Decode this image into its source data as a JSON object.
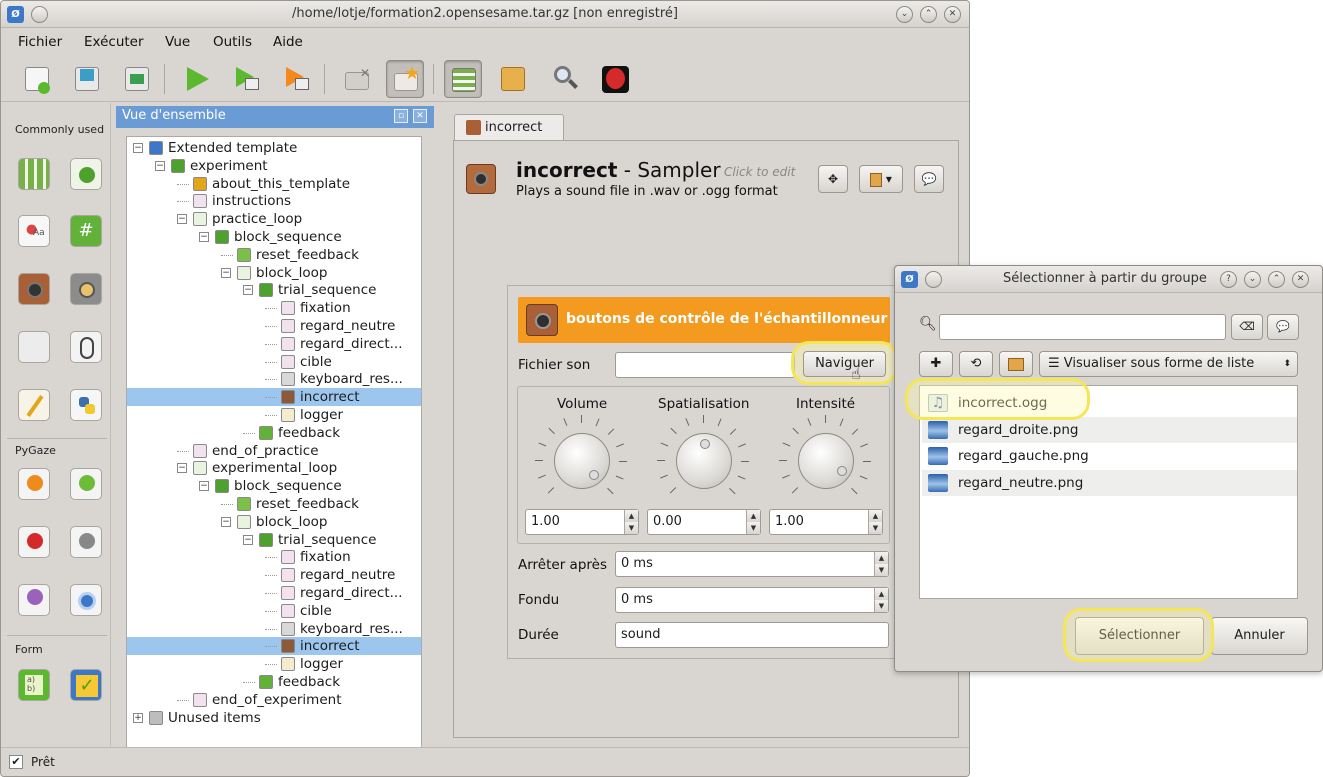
{
  "window": {
    "title": "/home/lotje/formation2.opensesame.tar.gz [non enregistré]",
    "app_icon": "opensesame-icon"
  },
  "menu": [
    "Fichier",
    "Exécuter",
    "Vue",
    "Outils",
    "Aide"
  ],
  "toolbar": {
    "icons": [
      "new-file-icon",
      "open-file-icon",
      "save-file-icon",
      "run-icon",
      "run-window-icon",
      "quick-run-icon",
      "close-tabs-icon",
      "close-other-tabs-icon",
      "overview-icon",
      "file-pool-icon",
      "debug-window-icon",
      "bug-icon"
    ]
  },
  "item_toolbar": {
    "categories": [
      "Commonly used",
      "PyGaze",
      "Form"
    ]
  },
  "overview": {
    "title": "Vue d'ensemble",
    "tree": [
      {
        "label": "Extended template",
        "depth": 0,
        "icon": "experiment-root-icon",
        "exp": "minus"
      },
      {
        "label": "experiment",
        "depth": 1,
        "icon": "sequence-icon",
        "exp": "minus"
      },
      {
        "label": "about_this_template",
        "depth": 2,
        "icon": "notepad-icon"
      },
      {
        "label": "instructions",
        "depth": 2,
        "icon": "sketchpad-icon"
      },
      {
        "label": "practice_loop",
        "depth": 2,
        "icon": "loop-icon",
        "exp": "minus"
      },
      {
        "label": "block_sequence",
        "depth": 3,
        "icon": "sequence-icon",
        "exp": "minus"
      },
      {
        "label": "reset_feedback",
        "depth": 4,
        "icon": "reset-feedback-icon"
      },
      {
        "label": "block_loop",
        "depth": 4,
        "icon": "loop-icon",
        "exp": "minus"
      },
      {
        "label": "trial_sequence",
        "depth": 5,
        "icon": "sequence-icon",
        "exp": "minus"
      },
      {
        "label": "fixation",
        "depth": 6,
        "icon": "sketchpad-icon"
      },
      {
        "label": "regard_neutre",
        "depth": 6,
        "icon": "sketchpad-icon"
      },
      {
        "label": "regard_direct...",
        "depth": 6,
        "icon": "sketchpad-icon"
      },
      {
        "label": "cible",
        "depth": 6,
        "icon": "sketchpad-icon"
      },
      {
        "label": "keyboard_res...",
        "depth": 6,
        "icon": "keyboard-icon"
      },
      {
        "label": "incorrect",
        "depth": 6,
        "icon": "sampler-icon",
        "selected": true
      },
      {
        "label": "logger",
        "depth": 6,
        "icon": "logger-icon"
      },
      {
        "label": "feedback",
        "depth": 5,
        "icon": "feedback-icon"
      },
      {
        "label": "end_of_practice",
        "depth": 2,
        "icon": "sketchpad-icon"
      },
      {
        "label": "experimental_loop",
        "depth": 2,
        "icon": "loop-icon",
        "exp": "minus"
      },
      {
        "label": "block_sequence",
        "depth": 3,
        "icon": "sequence-icon",
        "exp": "minus"
      },
      {
        "label": "reset_feedback",
        "depth": 4,
        "icon": "reset-feedback-icon"
      },
      {
        "label": "block_loop",
        "depth": 4,
        "icon": "loop-icon",
        "exp": "minus"
      },
      {
        "label": "trial_sequence",
        "depth": 5,
        "icon": "sequence-icon",
        "exp": "minus"
      },
      {
        "label": "fixation",
        "depth": 6,
        "icon": "sketchpad-icon"
      },
      {
        "label": "regard_neutre",
        "depth": 6,
        "icon": "sketchpad-icon"
      },
      {
        "label": "regard_direct...",
        "depth": 6,
        "icon": "sketchpad-icon"
      },
      {
        "label": "cible",
        "depth": 6,
        "icon": "sketchpad-icon"
      },
      {
        "label": "keyboard_res...",
        "depth": 6,
        "icon": "keyboard-icon"
      },
      {
        "label": "incorrect",
        "depth": 6,
        "icon": "sampler-icon",
        "selected": true
      },
      {
        "label": "logger",
        "depth": 6,
        "icon": "logger-icon"
      },
      {
        "label": "feedback",
        "depth": 5,
        "icon": "feedback-icon"
      },
      {
        "label": "end_of_experiment",
        "depth": 2,
        "icon": "sketchpad-icon"
      },
      {
        "label": "Unused items",
        "depth": 0,
        "icon": "trash-icon",
        "exp": "plus"
      }
    ]
  },
  "tab": {
    "label": "incorrect"
  },
  "item": {
    "name": "incorrect",
    "separator": " - ",
    "type": "Sampler",
    "click_to_edit": "Click to edit",
    "description": "Plays a sound file in .wav or .ogg format"
  },
  "controls": {
    "title": "boutons de contrôle de l'échantillonneur",
    "file_label": "Fichier son",
    "file_value": "",
    "browse": "Naviguer",
    "knobs": [
      {
        "label": "Volume",
        "value": "1.00"
      },
      {
        "label": "Spatialisation",
        "value": "0.00"
      },
      {
        "label": "Intensité",
        "value": "1.00"
      }
    ],
    "stop_after_label": "Arrêter après",
    "stop_after_value": "0 ms",
    "fade_label": "Fondu",
    "fade_value": "0 ms",
    "duration_label": "Durée",
    "duration_value": "sound"
  },
  "status": {
    "text": "Prêt"
  },
  "dialog": {
    "title": "Sélectionner à partir du groupe",
    "search_value": "",
    "view_mode": "Visualiser sous forme de liste",
    "files": [
      {
        "name": "incorrect.ogg",
        "icon": "audio-file-icon"
      },
      {
        "name": "regard_droite.png",
        "icon": "image-file-icon"
      },
      {
        "name": "regard_gauche.png",
        "icon": "image-file-icon"
      },
      {
        "name": "regard_neutre.png",
        "icon": "image-file-icon"
      }
    ],
    "select": "Sélectionner",
    "cancel": "Annuler"
  },
  "colors": {
    "accent_orange": "#f39a1f",
    "dock_title_blue": "#6b9bd4",
    "selection_blue": "#9cc6ee",
    "highlight_yellow": "#f5e658"
  }
}
